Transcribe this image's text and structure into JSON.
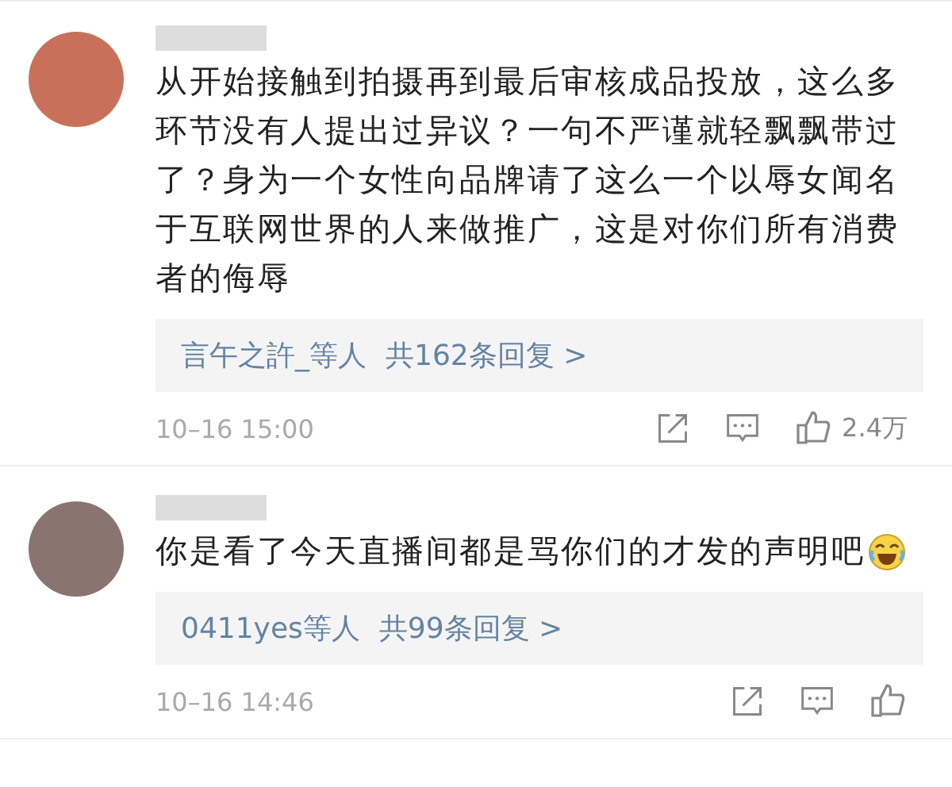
{
  "comments": [
    {
      "text": "从开始接触到拍摄再到最后审核成品投放，这么多环节没有人提出过异议？一句不严谨就轻飘飘带过了？身为一个女性向品牌请了这么一个以辱女闻名于互联网世界的人来做推广，这是对你们所有消费者的侮辱",
      "emoji": false,
      "replies": {
        "users": "言午之許_等人",
        "count": "共162条回复 >"
      },
      "time": "10–16 15:00",
      "likes": "2.4万"
    },
    {
      "text": "你是看了今天直播间都是骂你们的才发的声明吧",
      "emoji": true,
      "replies": {
        "users": "0411yes等人",
        "count": "共99条回复 >"
      },
      "time": "10–16 14:46"
    }
  ]
}
